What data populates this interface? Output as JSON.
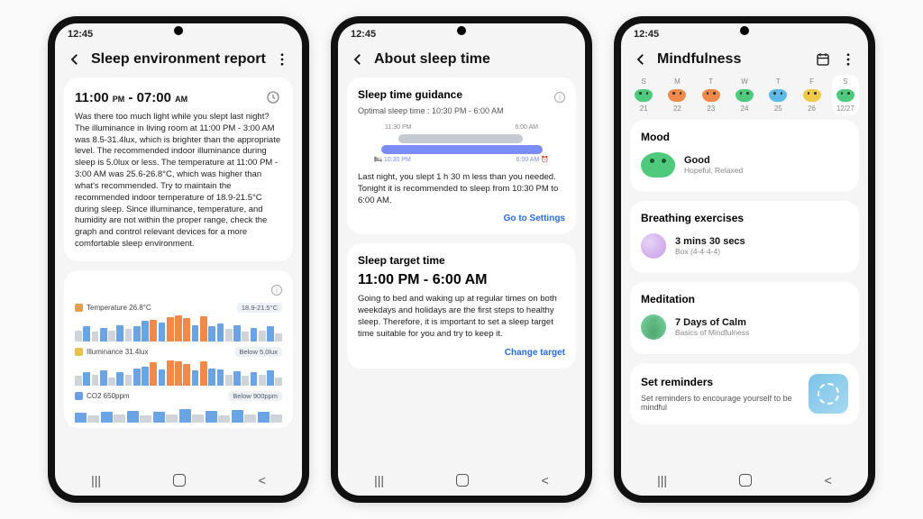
{
  "status": {
    "time": "12:45"
  },
  "phone1": {
    "title": "Sleep environment report",
    "time_from_h": "11:00",
    "time_from_p": "PM",
    "time_to_h": "07:00",
    "time_to_p": "AM",
    "body": "Was there too much light while you slept last night? The illuminance in living room at 11:00 PM - 3:00 AM was 8.5-31.4lux, which is brighter than the appropriate level. The recommended indoor illuminance during sleep is 5.0lux or less. The temperature at 11:00 PM - 3:00 AM was 25.6-26.8°C, which was higher than what's recommended. Try to maintain the recommended indoor temperature of 18.9-21.5°C during sleep. Since illuminance, temperature, and humidity are not within the proper range, check the graph and control relevant devices for a more comfortable sleep environment.",
    "charts": {
      "temp": {
        "label": "Temperature 26.8°C",
        "badge": "18.9-21.5°C",
        "color1": "#e3a24a"
      },
      "illum": {
        "label": "Illuminance 31.4lux",
        "badge": "Below 5.0lux",
        "color1": "#e8c14a"
      },
      "co2": {
        "label": "CO2 650ppm",
        "badge": "Below 900ppm",
        "color1": "#6a9ee8"
      }
    }
  },
  "phone2": {
    "title": "About sleep time",
    "card1_title": "Sleep time guidance",
    "optimal": "Optimal sleep time : 10:30 PM - 6:00 AM",
    "tl_t1": "11:30 PM",
    "tl_t2": "6:00 AM",
    "tl_b1": "10:30 PM",
    "tl_b2": "6:00 AM",
    "guidance": "Last night, you slept 1 h 30 m less than you needed. Tonight it is recommended to sleep from 10:30 PM to 6:00 AM.",
    "link1": "Go to Settings",
    "card2_title": "Sleep target time",
    "target_range": "11:00 PM - 6:00 AM",
    "target_body": "Going to bed and waking up at regular times on both weekdays and holidays are the first steps to healthy sleep. Therefore, it is important to set a sleep target time suitable for you and try to keep it.",
    "link2": "Change target"
  },
  "phone3": {
    "title": "Mindfulness",
    "days": [
      {
        "dn": "S",
        "dt": "21",
        "c": "#4fc97c"
      },
      {
        "dn": "M",
        "dt": "22",
        "c": "#f08a4a"
      },
      {
        "dn": "T",
        "dt": "23",
        "c": "#f08a4a"
      },
      {
        "dn": "W",
        "dt": "24",
        "c": "#4fc97c"
      },
      {
        "dn": "T",
        "dt": "25",
        "c": "#5fb8e8"
      },
      {
        "dn": "F",
        "dt": "26",
        "c": "#f0c94a"
      },
      {
        "dn": "S",
        "dt": "12/27",
        "c": "#4fc97c"
      }
    ],
    "mood_title": "Mood",
    "mood_val": "Good",
    "mood_sub": "Hopeful, Relaxed",
    "breath_title": "Breathing exercises",
    "breath_val": "3 mins 30 secs",
    "breath_sub": "Box (4-4-4-4)",
    "med_title": "Meditation",
    "med_val": "7 Days of Calm",
    "med_sub": "Basics of Mindfulness",
    "rem_title": "Set reminders",
    "rem_body": "Set reminders to encourage yourself to be mindful"
  },
  "chart_data": [
    {
      "type": "bar",
      "title": "Temperature 26.8°C",
      "series": [
        {
          "name": "actual",
          "color": "#f08a4a"
        },
        {
          "name": "rec",
          "color": "#6aa4e4"
        },
        {
          "name": "off",
          "color": "#cfd4da"
        }
      ],
      "values": [
        [
          "off",
          40
        ],
        [
          "rec",
          55
        ],
        [
          "off",
          35
        ],
        [
          "rec",
          50
        ],
        [
          "off",
          40
        ],
        [
          "rec",
          60
        ],
        [
          "off",
          45
        ],
        [
          "rec",
          55
        ],
        [
          "rec",
          75
        ],
        [
          "actual",
          80
        ],
        [
          "rec",
          70
        ],
        [
          "actual",
          90
        ],
        [
          "actual",
          95
        ],
        [
          "actual",
          85
        ],
        [
          "rec",
          60
        ],
        [
          "actual",
          92
        ],
        [
          "rec",
          55
        ],
        [
          "rec",
          65
        ],
        [
          "off",
          45
        ],
        [
          "rec",
          60
        ],
        [
          "off",
          35
        ],
        [
          "rec",
          50
        ],
        [
          "off",
          40
        ],
        [
          "rec",
          55
        ],
        [
          "off",
          30
        ]
      ]
    },
    {
      "type": "bar",
      "title": "Illuminance 31.4lux",
      "values": [
        [
          "off",
          35
        ],
        [
          "rec",
          50
        ],
        [
          "off",
          40
        ],
        [
          "rec",
          55
        ],
        [
          "off",
          30
        ],
        [
          "rec",
          48
        ],
        [
          "off",
          38
        ],
        [
          "rec",
          62
        ],
        [
          "rec",
          70
        ],
        [
          "actual",
          85
        ],
        [
          "rec",
          60
        ],
        [
          "actual",
          92
        ],
        [
          "actual",
          88
        ],
        [
          "actual",
          80
        ],
        [
          "rec",
          55
        ],
        [
          "actual",
          90
        ],
        [
          "rec",
          62
        ],
        [
          "rec",
          58
        ],
        [
          "off",
          40
        ],
        [
          "rec",
          52
        ],
        [
          "off",
          35
        ],
        [
          "rec",
          50
        ],
        [
          "off",
          38
        ],
        [
          "rec",
          55
        ],
        [
          "off",
          30
        ]
      ]
    },
    {
      "type": "bar",
      "title": "CO2 650ppm",
      "values": [
        [
          "rec",
          50
        ],
        [
          "off",
          35
        ],
        [
          "rec",
          55
        ],
        [
          "off",
          40
        ],
        [
          "rec",
          60
        ],
        [
          "off",
          35
        ],
        [
          "rec",
          52
        ],
        [
          "off",
          38
        ],
        [
          "rec",
          65
        ],
        [
          "off",
          40
        ],
        [
          "rec",
          58
        ],
        [
          "off",
          35
        ],
        [
          "rec",
          62
        ],
        [
          "off",
          42
        ],
        [
          "rec",
          55
        ],
        [
          "off",
          38
        ]
      ]
    }
  ]
}
